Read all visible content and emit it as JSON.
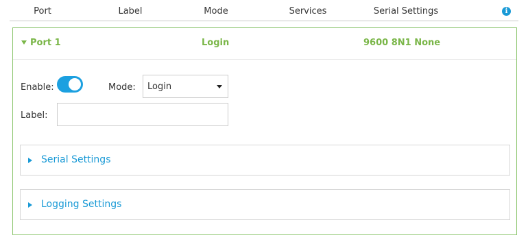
{
  "table_header": {
    "columns": [
      "Port",
      "Label",
      "Mode",
      "Services",
      "Serial Settings"
    ],
    "info_icon": "info-icon"
  },
  "port": {
    "name": "Port 1",
    "label": "",
    "mode": "Login",
    "services": "",
    "serial_settings": "9600 8N1 None",
    "expanded": true
  },
  "form": {
    "enable_label": "Enable:",
    "enable_on": true,
    "mode_label": "Mode:",
    "mode_value": "Login",
    "label_label": "Label:",
    "label_value": "",
    "label_placeholder": ""
  },
  "sections": [
    {
      "title": "Serial Settings",
      "expanded": false
    },
    {
      "title": "Logging Settings",
      "expanded": false
    }
  ],
  "colors": {
    "accent_blue": "#1a9ad6",
    "toggle_on": "#1ca0e0",
    "port_green": "#7ab648",
    "panel_border": "#8cc56e"
  }
}
